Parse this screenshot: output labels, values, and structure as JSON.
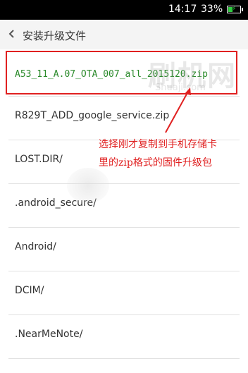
{
  "status_bar": {
    "time": "14:17",
    "battery_percent": "33%",
    "battery_icon": "battery-charging-icon",
    "battery_color": "#2ecc40"
  },
  "header": {
    "back_icon": "chevron-left-icon",
    "title": "安装升级文件"
  },
  "files": [
    {
      "name": "A53_11_A.07_OTA_007_all_2015120.zip",
      "selected": true
    },
    {
      "name": "R829T_ADD_google_service.zip"
    },
    {
      "name": "LOST.DIR/"
    },
    {
      "name": ".android_secure/"
    },
    {
      "name": "Android/"
    },
    {
      "name": "DCIM/"
    },
    {
      "name": ".NearMeNote/"
    }
  ],
  "annotation": {
    "line1": "选择刚才复制到手机存储卡",
    "line2": "里的zip格式的固件升级包",
    "color": "#e02020"
  },
  "watermark": {
    "main": "刷机网",
    "sub": "Shuaji.com"
  },
  "colors": {
    "selected_text": "#2a8a2a",
    "highlight_border": "#e02020"
  }
}
